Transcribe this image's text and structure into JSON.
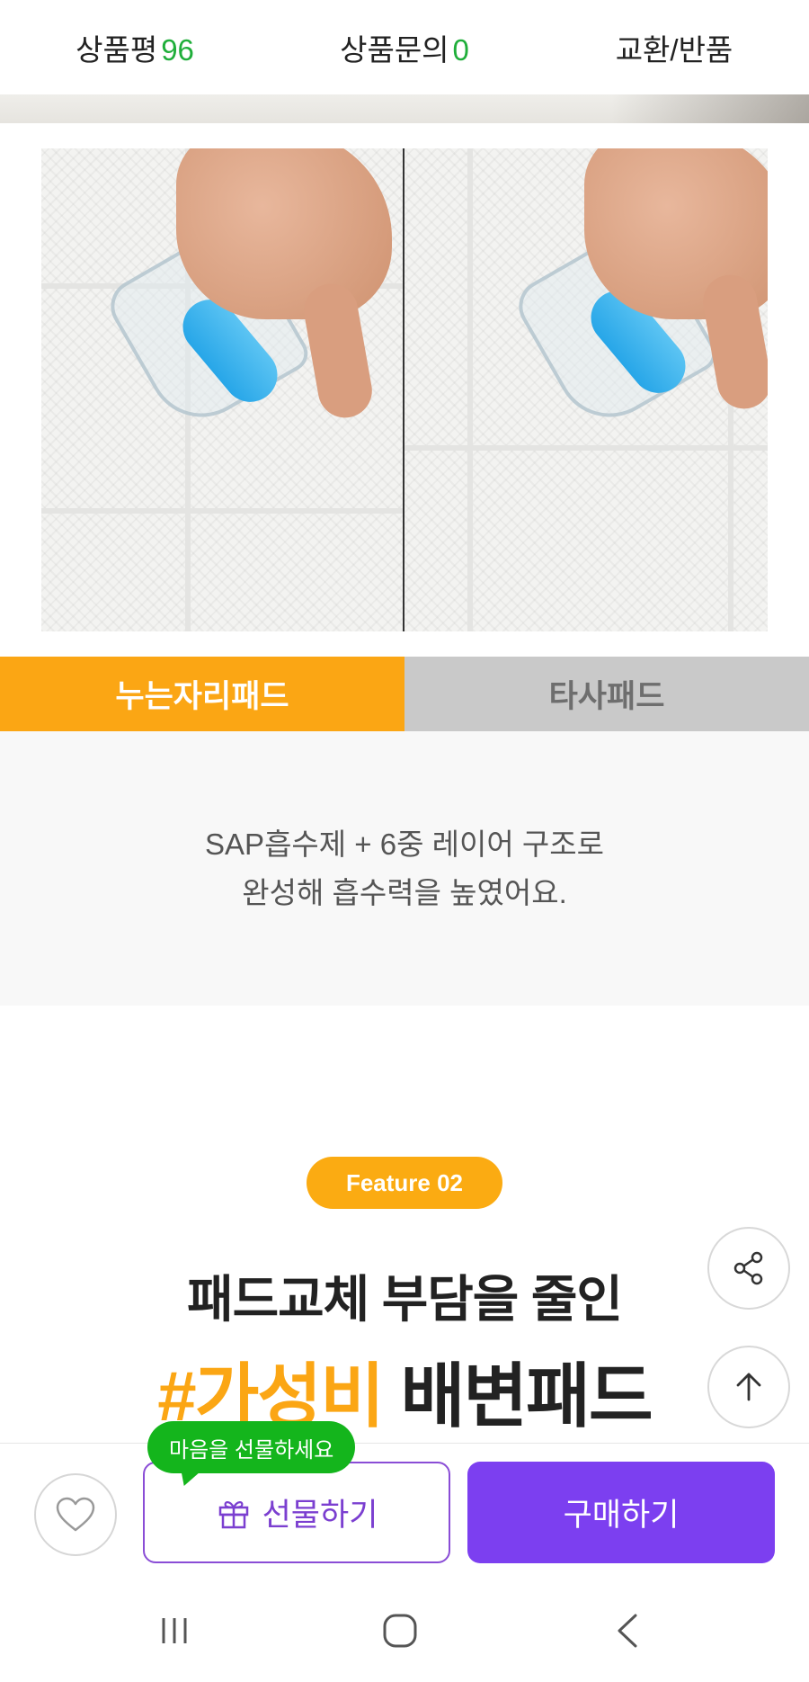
{
  "tabs": [
    {
      "label": "상품평",
      "count": "96"
    },
    {
      "label": "상품문의",
      "count": "0"
    },
    {
      "label": "교환/반품",
      "count": ""
    }
  ],
  "comparison": {
    "ours_label": "누는자리패드",
    "other_label": "타사패드"
  },
  "description": {
    "line1": "SAP흡수제 + 6중 레이어 구조로",
    "line2": "완성해 흡수력을 높였어요."
  },
  "feature": {
    "badge": "Feature 02",
    "headline1": "패드교체 부담을 줄인",
    "headline2_accent": "#가성비",
    "headline2_rest": " 배변패드"
  },
  "bottom_bar": {
    "tooltip": "마음을 선물하세요",
    "gift_label": "선물하기",
    "buy_label": "구매하기"
  },
  "icons": {
    "share": "share-icon",
    "scroll_top": "arrow-up-icon",
    "wishlist": "heart-icon",
    "gift": "gift-icon",
    "nav_recent": "recent-apps-icon",
    "nav_home": "home-icon",
    "nav_back": "back-icon"
  },
  "colors": {
    "accent_orange": "#fba614",
    "count_green": "#1fae3a",
    "purple": "#7c3ff0",
    "tooltip_green": "#14b51c"
  }
}
